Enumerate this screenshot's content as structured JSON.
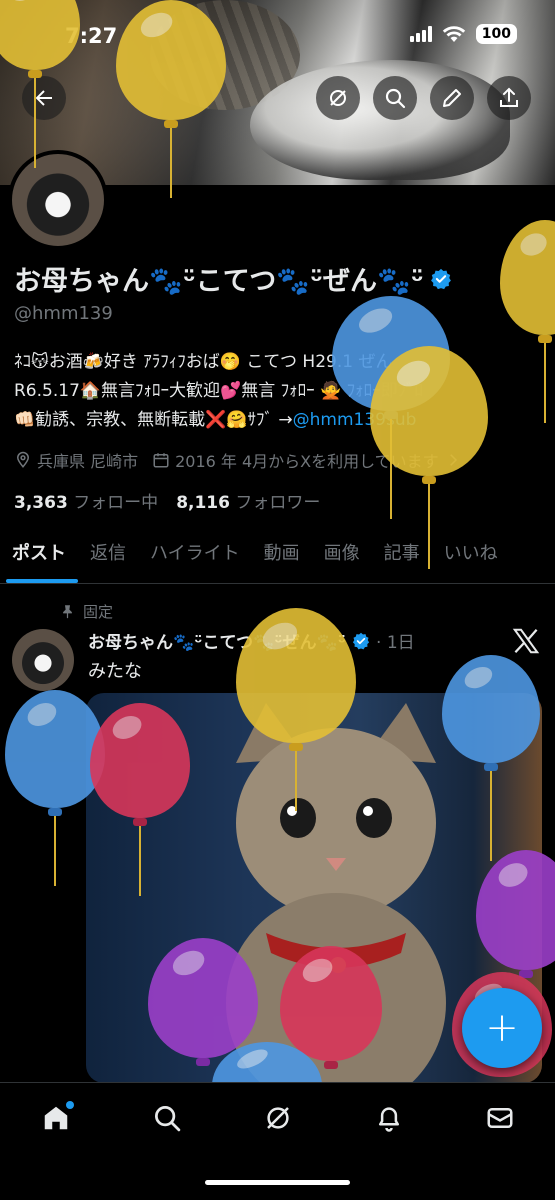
{
  "status_bar": {
    "time": "7:27",
    "battery": "100"
  },
  "header": {
    "back_icon": "arrow-left-icon",
    "grok_icon": "grok-icon",
    "search_icon": "search-icon",
    "edit_icon": "pencil-icon",
    "share_icon": "share-icon"
  },
  "profile": {
    "display_name": "お母ちゃん🐾ᵕ̈こてつ🐾ᵕ̈ぜん🐾ᵕ̈",
    "handle": "@hmm139",
    "bio_line1": "ﾈｺ😽お酒🍻好き ｱﾗﾌｨﾌおば🤭 こてつ H29.1 ぜん",
    "bio_line2": "R6.5.17🏠無言ﾌｫﾛｰ大歓迎💕無言 ﾌｫﾛｰ 🙅 ﾌｫﾛｰ即ﾌﾞﾛ",
    "bio_line3_text": "👊🏻勧誘、宗教、無断転載❌🤗ｻﾌﾞ →",
    "bio_line3_link": "@hmm139sub",
    "location": "兵庫県 尼崎市",
    "joined": "2016 年 4月からXを利用しています",
    "following_count": "3,363",
    "following_label": "フォロー中",
    "followers_count": "8,116",
    "followers_label": "フォロワー"
  },
  "tabs": [
    "ポスト",
    "返信",
    "ハイライト",
    "動画",
    "画像",
    "記事",
    "いいね"
  ],
  "pinned_post": {
    "pinned_label": "固定",
    "author": "お母ちゃん🐾ᵕ̈こてつ🐾ᵕ̈ぜん🐾ᵕ̈",
    "time": "· 1日",
    "text": "みたな"
  },
  "fab": {
    "label": "+"
  },
  "bottom_nav": [
    "home-icon",
    "search-icon",
    "grok-icon",
    "bell-icon",
    "mail-icon"
  ],
  "colors": {
    "accent": "#1d9bf0",
    "muted": "#71767b",
    "text": "#e7e9ea",
    "background": "#000000"
  }
}
